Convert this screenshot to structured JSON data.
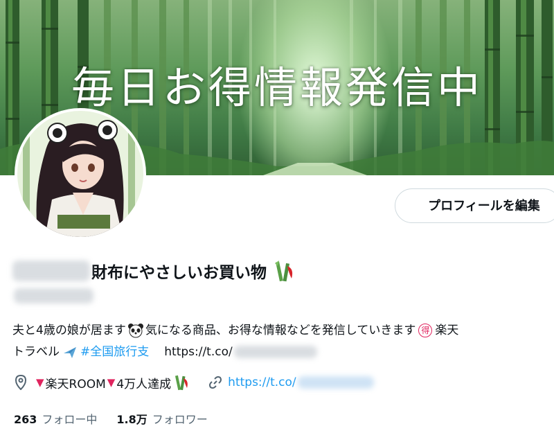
{
  "banner": {
    "title": "毎日お得情報発信中"
  },
  "profile": {
    "name_text": "財布にやさしいお買い物",
    "name_emoji": "bamboo-emoji",
    "edit_button_label": "プロフィールを編集"
  },
  "bio": {
    "line1_part1": "夫と4歳の娘が居ます",
    "line1_part2": "気になる商品、お得な情報などを発信していきます",
    "toku_badge": "得",
    "line1_part3": "楽天",
    "line2_part1": "トラベル",
    "hashtag": "#全国旅行支",
    "url_text": "https://t.co/"
  },
  "meta": {
    "location_text": "楽天ROOM",
    "location_text2": "4万人達成",
    "website_text": "https://t.co/"
  },
  "stats": {
    "following_count": "263",
    "following_label": "フォロー中",
    "followers_count": "1.8万",
    "followers_label": "フォロワー"
  },
  "colors": {
    "link": "#1d9bf0",
    "text": "#0f1419",
    "secondary": "#536471",
    "heart": "#e0245e",
    "border": "#cfd9de"
  }
}
